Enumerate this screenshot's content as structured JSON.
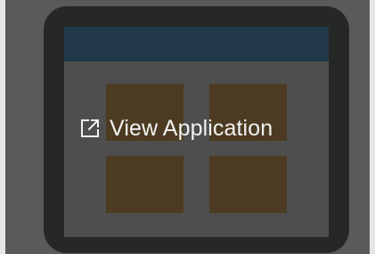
{
  "card": {
    "action_label": "View Application",
    "action_icon": "external-link-icon",
    "text_color": "#f2f2f2",
    "frame_color": "#262828",
    "header_color": "#22394a",
    "tile_color": "#4c3b22",
    "overlay_color": "#5a5a5a"
  }
}
